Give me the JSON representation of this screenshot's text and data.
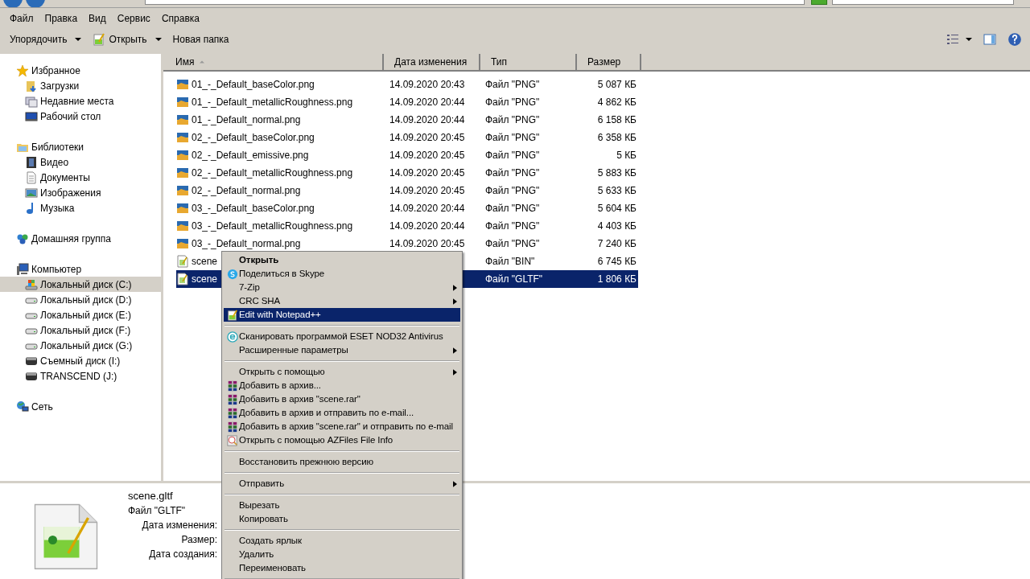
{
  "menu_bar": [
    "Файл",
    "Правка",
    "Вид",
    "Сервис",
    "Справка"
  ],
  "toolbar": {
    "buttons": [
      {
        "label": "Упорядочить",
        "kind": "menu"
      },
      {
        "label": "Открыть",
        "kind": "open"
      },
      {
        "label": "Новая папка",
        "kind": "plain"
      }
    ]
  },
  "sidebar": {
    "groups": [
      {
        "label": "Избранное",
        "kind": "star",
        "children": [
          {
            "label": "Загрузки",
            "kind": "folder",
            "selected": false
          },
          {
            "label": "Недавние места",
            "kind": "recent",
            "selected": false
          },
          {
            "label": "Рабочий стол",
            "kind": "desktop",
            "selected": false
          }
        ]
      },
      {
        "label": "Библиотеки",
        "kind": "library",
        "children": [
          {
            "label": "Видео",
            "kind": "video",
            "selected": false
          },
          {
            "label": "Документы",
            "kind": "docs",
            "selected": false
          },
          {
            "label": "Изображения",
            "kind": "images",
            "selected": false
          },
          {
            "label": "Музыка",
            "kind": "music",
            "selected": false
          }
        ]
      },
      {
        "label": "Домашняя группа",
        "kind": "homegroup"
      },
      {
        "label": "Компьютер",
        "kind": "computer",
        "children": [
          {
            "label": "Локальный диск (C:)",
            "kind": "system_drive",
            "selected": true
          },
          {
            "label": "Локальный диск (D:)",
            "kind": "drive",
            "selected": false
          },
          {
            "label": "Локальный диск (E:)",
            "kind": "drive",
            "selected": false
          },
          {
            "label": "Локальный диск (F:)",
            "kind": "drive",
            "selected": false
          },
          {
            "label": "Локальный диск (G:)",
            "kind": "drive",
            "selected": false
          },
          {
            "label": "Съемный диск (I:)",
            "kind": "removable",
            "selected": false
          },
          {
            "label": "TRANSCEND (J:)",
            "kind": "removable",
            "selected": false
          }
        ]
      },
      {
        "label": "Сеть",
        "kind": "network"
      }
    ]
  },
  "file_list": {
    "columns": [
      {
        "label": "Имя",
        "sorted": true
      },
      {
        "label": "Дата изменения",
        "sorted": false
      },
      {
        "label": "Тип",
        "sorted": false
      },
      {
        "label": "Размер",
        "sorted": false
      }
    ],
    "rows": [
      {
        "name": "01_-_Default_baseColor.png",
        "date": "14.09.2020 20:43",
        "type": "Файл \"PNG\"",
        "size": "5 087 КБ",
        "kind": "image",
        "selected": false
      },
      {
        "name": "01_-_Default_metallicRoughness.png",
        "date": "14.09.2020 20:44",
        "type": "Файл \"PNG\"",
        "size": "4 862 КБ",
        "kind": "image",
        "selected": false
      },
      {
        "name": "01_-_Default_normal.png",
        "date": "14.09.2020 20:44",
        "type": "Файл \"PNG\"",
        "size": "6 158 КБ",
        "kind": "image",
        "selected": false
      },
      {
        "name": "02_-_Default_baseColor.png",
        "date": "14.09.2020 20:45",
        "type": "Файл \"PNG\"",
        "size": "6 358 КБ",
        "kind": "image",
        "selected": false
      },
      {
        "name": "02_-_Default_emissive.png",
        "date": "14.09.2020 20:45",
        "type": "Файл \"PNG\"",
        "size": "5 КБ",
        "kind": "image",
        "selected": false
      },
      {
        "name": "02_-_Default_metallicRoughness.png",
        "date": "14.09.2020 20:45",
        "type": "Файл \"PNG\"",
        "size": "5 883 КБ",
        "kind": "image",
        "selected": false
      },
      {
        "name": "02_-_Default_normal.png",
        "date": "14.09.2020 20:45",
        "type": "Файл \"PNG\"",
        "size": "5 633 КБ",
        "kind": "image",
        "selected": false
      },
      {
        "name": "03_-_Default_baseColor.png",
        "date": "14.09.2020 20:44",
        "type": "Файл \"PNG\"",
        "size": "5 604 КБ",
        "kind": "image",
        "selected": false
      },
      {
        "name": "03_-_Default_metallicRoughness.png",
        "date": "14.09.2020 20:44",
        "type": "Файл \"PNG\"",
        "size": "4 403 КБ",
        "kind": "image",
        "selected": false
      },
      {
        "name": "03_-_Default_normal.png",
        "date": "14.09.2020 20:45",
        "type": "Файл \"PNG\"",
        "size": "7 240 КБ",
        "kind": "image",
        "selected": false
      },
      {
        "name": "scene",
        "type": "Файл \"BIN\"",
        "size": "6 745 КБ",
        "kind": "document",
        "selected": false
      },
      {
        "name": "scene",
        "type": "Файл \"GLTF\"",
        "size": "1 806 КБ",
        "kind": "document",
        "selected": true
      }
    ]
  },
  "context_menu": {
    "items": [
      {
        "kind": "item",
        "label": "Открыть",
        "bold": true,
        "submenu": false,
        "highlighted": false
      },
      {
        "kind": "item",
        "label": "Поделиться в Skype",
        "bold": false,
        "submenu": false,
        "highlighted": false
      },
      {
        "kind": "item",
        "label": "7-Zip",
        "bold": false,
        "submenu": true,
        "highlighted": false
      },
      {
        "kind": "item",
        "label": "CRC SHA",
        "bold": false,
        "submenu": true,
        "highlighted": false
      },
      {
        "kind": "item",
        "label": "Edit with Notepad++",
        "bold": false,
        "submenu": false,
        "highlighted": true
      },
      {
        "kind": "separator"
      },
      {
        "kind": "item",
        "label": "Сканировать программой ESET NOD32 Antivirus",
        "bold": false,
        "submenu": false,
        "highlighted": false
      },
      {
        "kind": "item",
        "label": "Расширенные параметры",
        "bold": false,
        "submenu": true,
        "highlighted": false
      },
      {
        "kind": "separator"
      },
      {
        "kind": "item",
        "label": "Открыть с помощью",
        "bold": false,
        "submenu": true,
        "highlighted": false
      },
      {
        "kind": "item",
        "label": "Добавить в архив...",
        "bold": false,
        "submenu": false,
        "highlighted": false
      },
      {
        "kind": "item",
        "label": "Добавить в архив \"scene.rar\"",
        "bold": false,
        "submenu": false,
        "highlighted": false
      },
      {
        "kind": "item",
        "label": "Добавить в архив и отправить по e-mail...",
        "bold": false,
        "submenu": false,
        "highlighted": false
      },
      {
        "kind": "item",
        "label": "Добавить в архив \"scene.rar\" и отправить по e-mail",
        "bold": false,
        "submenu": false,
        "highlighted": false
      },
      {
        "kind": "item",
        "label": "Открыть с помощью AZFiles File Info",
        "bold": false,
        "submenu": false,
        "highlighted": false
      },
      {
        "kind": "separator"
      },
      {
        "kind": "item",
        "label": "Восстановить прежнюю версию",
        "bold": false,
        "submenu": false,
        "highlighted": false
      },
      {
        "kind": "separator"
      },
      {
        "kind": "item",
        "label": "Отправить",
        "bold": false,
        "submenu": true,
        "highlighted": false
      },
      {
        "kind": "separator"
      },
      {
        "kind": "item",
        "label": "Вырезать",
        "bold": false,
        "submenu": false,
        "highlighted": false
      },
      {
        "kind": "item",
        "label": "Копировать",
        "bold": false,
        "submenu": false,
        "highlighted": false
      },
      {
        "kind": "separator"
      },
      {
        "kind": "item",
        "label": "Создать ярлык",
        "bold": false,
        "submenu": false,
        "highlighted": false
      },
      {
        "kind": "item",
        "label": "Удалить",
        "bold": false,
        "submenu": false,
        "highlighted": false
      },
      {
        "kind": "item",
        "label": "Переименовать",
        "bold": false,
        "submenu": false,
        "highlighted": false
      },
      {
        "kind": "separator"
      }
    ]
  },
  "details": {
    "file_name": "scene.gltf",
    "file_type": "Файл \"GLTF\"",
    "fields": [
      "Дата изменения:",
      "Размер:",
      "Дата создания:"
    ]
  }
}
